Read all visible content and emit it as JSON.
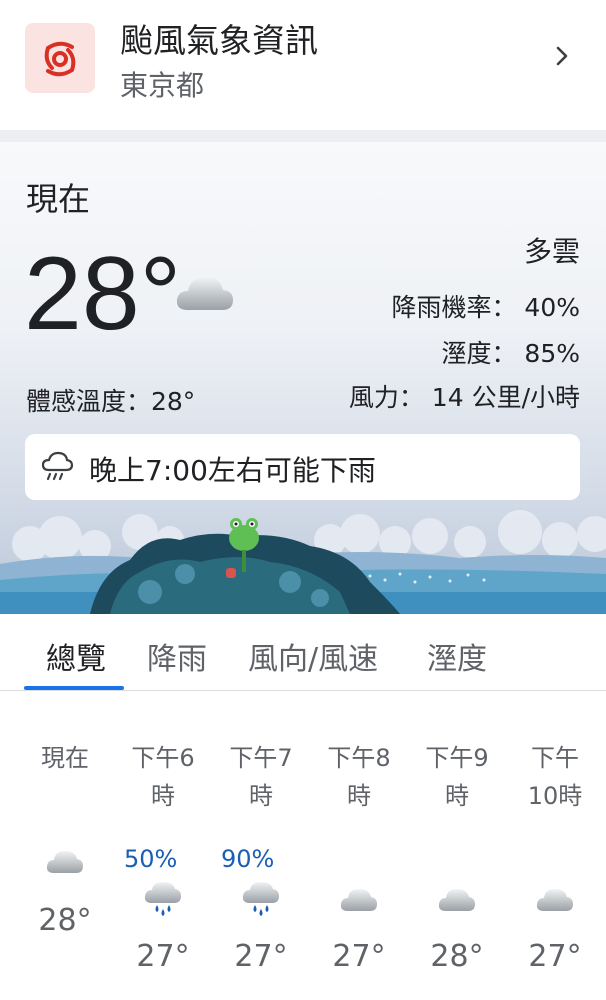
{
  "typhoon": {
    "title": "颱風氣象資訊",
    "location": "東京都",
    "icon": "typhoon-icon",
    "accent": "#d93025"
  },
  "current": {
    "label": "現在",
    "temperature": "28°",
    "condition": "多雲",
    "condition_icon": "cloud-icon",
    "feels_like": "體感溫度：28°",
    "precip_chance": "降雨機率： 40%",
    "humidity": "溼度： 85%",
    "wind": "風力： 14 公里/小時"
  },
  "alert": {
    "icon": "rain-cloud-icon",
    "text": "晚上7:00左右可能下雨"
  },
  "tabs": [
    {
      "label": "總覽",
      "active": true
    },
    {
      "label": "降雨",
      "active": false
    },
    {
      "label": "風向/風速",
      "active": false
    },
    {
      "label": "溼度",
      "active": false
    }
  ],
  "hourly": [
    {
      "time": "現在",
      "precip": "",
      "icon": "cloud-icon",
      "temp": "28°"
    },
    {
      "time": "下午6\n時",
      "precip": "50%",
      "icon": "rain-cloud-icon",
      "temp": "27°"
    },
    {
      "time": "下午7\n時",
      "precip": "90%",
      "icon": "rain-cloud-icon",
      "temp": "27°"
    },
    {
      "time": "下午8\n時",
      "precip": "",
      "icon": "cloud-icon",
      "temp": "27°"
    },
    {
      "time": "下午9\n時",
      "precip": "",
      "icon": "cloud-icon",
      "temp": "28°"
    },
    {
      "time": "下午\n10時",
      "precip": "",
      "icon": "cloud-icon",
      "temp": "27°"
    }
  ],
  "colors": {
    "accent_blue": "#1a73e8",
    "precip_blue": "#1a5fb4"
  }
}
